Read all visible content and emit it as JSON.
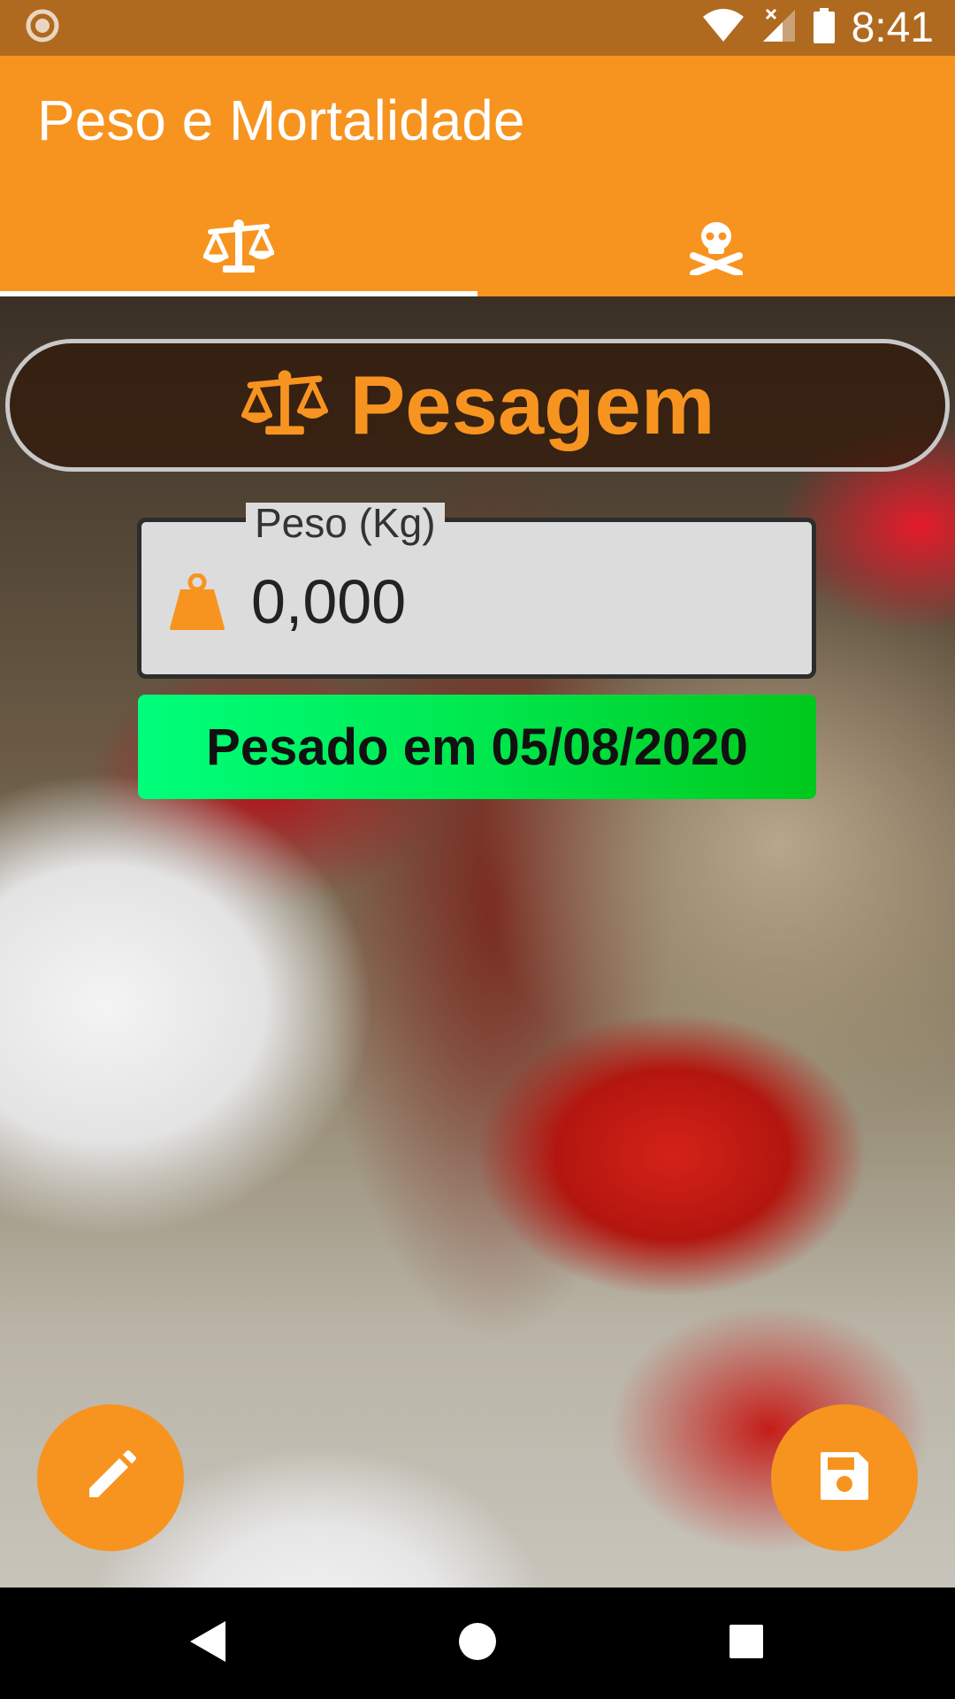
{
  "status_bar": {
    "time": "8:41",
    "icons": [
      "record-icon",
      "wifi-icon",
      "signal-icon",
      "battery-icon"
    ]
  },
  "app_bar": {
    "title": "Peso e Mortalidade",
    "tabs": [
      {
        "icon": "scale-icon",
        "selected": true
      },
      {
        "icon": "skull-crossbones-icon",
        "selected": false
      }
    ]
  },
  "section": {
    "header_icon": "scale-icon",
    "header_title": "Pesagem"
  },
  "weight_field": {
    "label": "Peso (Kg)",
    "value": "0,000",
    "icon": "weight-icon"
  },
  "date_button": {
    "label": "Pesado em 05/08/2020"
  },
  "fabs": {
    "edit_icon": "pencil-icon",
    "save_icon": "floppy-disk-icon"
  },
  "nav_bar": {
    "icons": [
      "back-icon",
      "home-icon",
      "recents-icon"
    ]
  },
  "colors": {
    "accent": "#f79420",
    "status_bar": "#b06a1f",
    "date_button_start": "#00ff7c",
    "date_button_end": "#00c81c"
  }
}
